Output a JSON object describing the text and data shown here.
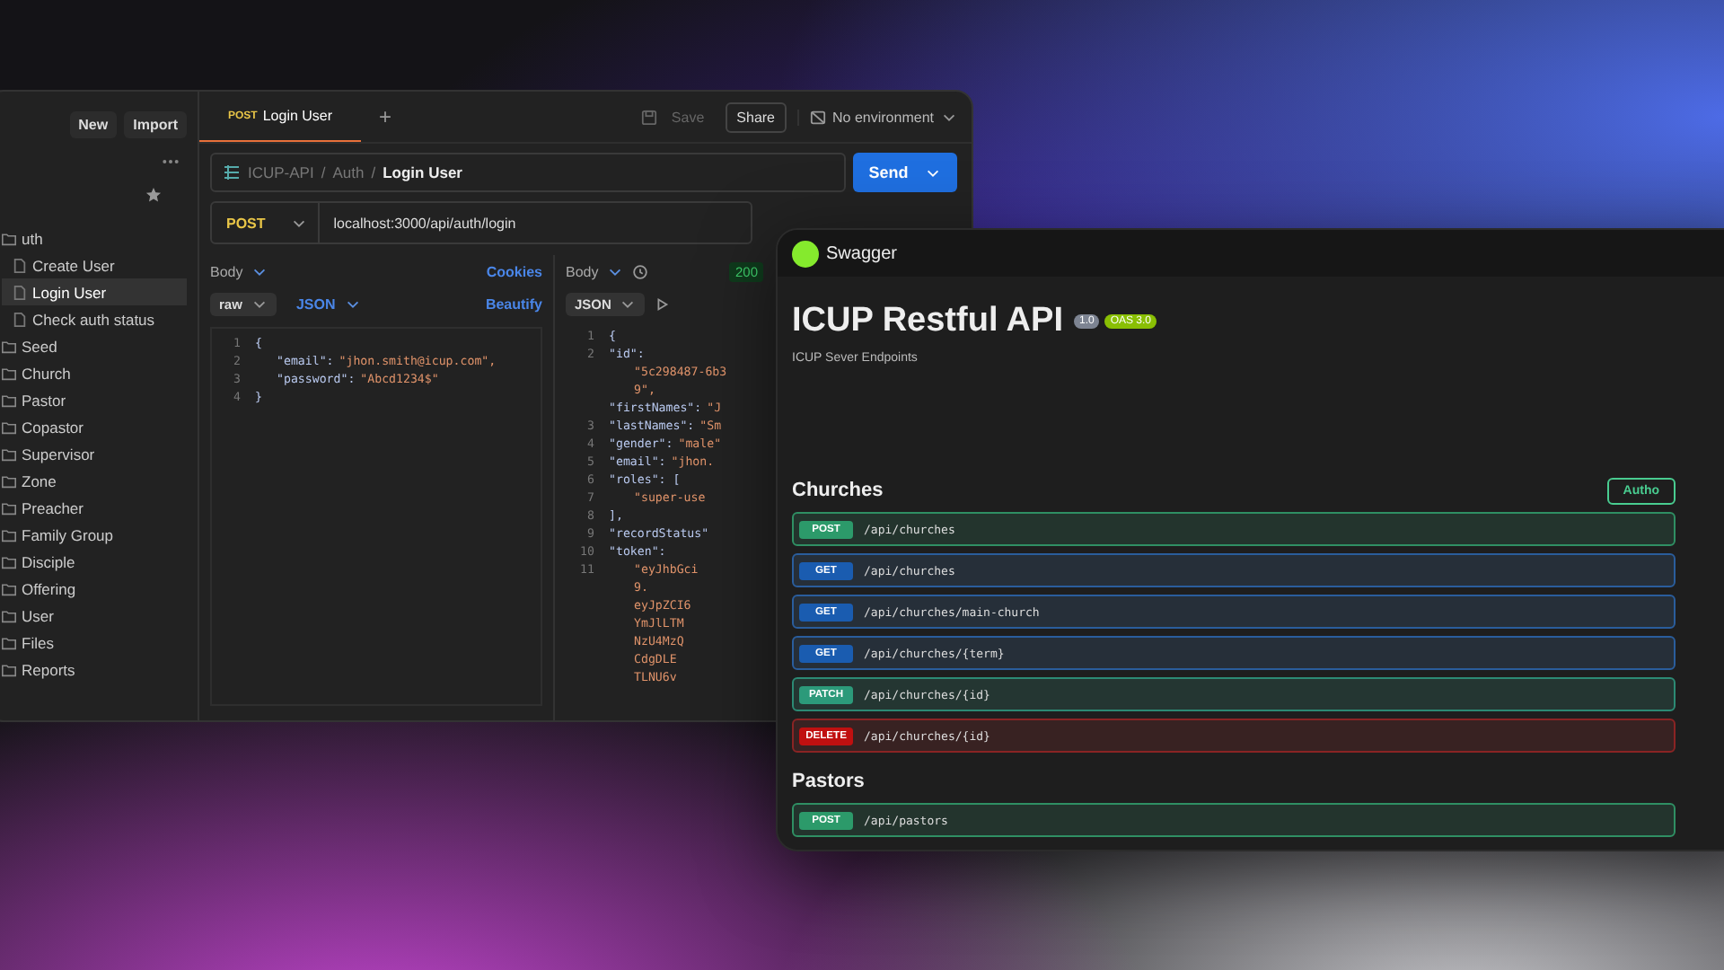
{
  "postman": {
    "sidebar": {
      "buttons": [
        "New",
        "Import"
      ],
      "items": [
        {
          "label": "uth",
          "kind": "folder",
          "selected": false,
          "children": [
            {
              "label": "Create User",
              "kind": "request",
              "selected": false
            },
            {
              "label": "Login User",
              "kind": "request",
              "selected": true
            },
            {
              "label": "Check auth status",
              "kind": "request",
              "selected": false
            }
          ]
        },
        {
          "label": "Seed",
          "kind": "folder",
          "selected": false
        },
        {
          "label": "Church",
          "kind": "folder",
          "selected": false
        },
        {
          "label": "Pastor",
          "kind": "folder",
          "selected": false
        },
        {
          "label": "Copastor",
          "kind": "folder",
          "selected": false
        },
        {
          "label": "Supervisor",
          "kind": "folder",
          "selected": false
        },
        {
          "label": "Zone",
          "kind": "folder",
          "selected": false
        },
        {
          "label": "Preacher",
          "kind": "folder",
          "selected": false
        },
        {
          "label": "Family Group",
          "kind": "folder",
          "selected": false
        },
        {
          "label": "Disciple",
          "kind": "folder",
          "selected": false
        },
        {
          "label": "Offering",
          "kind": "folder",
          "selected": false
        },
        {
          "label": "User",
          "kind": "folder",
          "selected": false
        },
        {
          "label": "Files",
          "kind": "folder",
          "selected": false
        },
        {
          "label": "Reports",
          "kind": "folder",
          "selected": false
        }
      ]
    },
    "tabs": [
      {
        "method": "POST",
        "label": "Login User",
        "selected": true
      }
    ],
    "add_tab": "+",
    "environment": "No environment",
    "save": "Save",
    "share": "Share",
    "breadcrumb": {
      "parts": [
        "ICUP-API",
        "Auth",
        "Login User"
      ],
      "separator": "/"
    },
    "send": "Send",
    "request": {
      "method": "POST",
      "url": "localhost:3000/api/auth/login",
      "body_label": "Body",
      "cookies": "Cookies",
      "beautify": "Beautify",
      "mode": "raw",
      "format": "JSON",
      "lines": [
        {
          "num": "1",
          "key": "{"
        },
        {
          "num": "2",
          "key": "\"email\":",
          "value": "\"jhon.smith@icup.com\","
        },
        {
          "num": "3",
          "key": "\"password\":",
          "value": "\"Abcd1234$\""
        },
        {
          "num": "4",
          "key": "}"
        }
      ]
    },
    "response": {
      "body_label": "Body",
      "format": "JSON",
      "status": "200",
      "lines": [
        {
          "num": "1",
          "key": "{"
        },
        {
          "num": "2",
          "key": "\"id\":"
        },
        {
          "value": "\"5c298487-6b3"
        },
        {
          "value": "9\","
        },
        {
          "key": "\"firstNames\":",
          "value": "\"J"
        },
        {
          "num": "3",
          "key": "\"lastNames\":",
          "value": "\"Sm"
        },
        {
          "num": "4",
          "key": "\"gender\":",
          "value": "\"male\""
        },
        {
          "num": "5",
          "key": "\"email\":",
          "value": "\"jhon."
        },
        {
          "num": "6",
          "key": "\"roles\": ["
        },
        {
          "num": "7",
          "value": "\"super-use"
        },
        {
          "num": "8",
          "key": "],"
        },
        {
          "num": "9",
          "key": "\"recordStatus\""
        },
        {
          "num": "10",
          "key": "\"token\":"
        },
        {
          "num": "11",
          "value": "\"eyJhbGci"
        },
        {
          "value": "9."
        },
        {
          "value": "eyJpZCI6"
        },
        {
          "value": "YmJlLTM"
        },
        {
          "value": "NzU4MzQ"
        },
        {
          "value": "CdgDLE"
        },
        {
          "value": "TLNU6v"
        }
      ]
    }
  },
  "swagger": {
    "brand": "Swagger",
    "title": "ICUP Restful API",
    "version": "1.0",
    "oas": "OAS 3.0",
    "description": "ICUP Sever Endpoints",
    "authorize": "Autho",
    "sections": [
      {
        "name": "Churches",
        "endpoints": [
          {
            "method": "POST",
            "kind": "post",
            "path": "/api/churches"
          },
          {
            "method": "GET",
            "kind": "get",
            "path": "/api/churches"
          },
          {
            "method": "GET",
            "kind": "get",
            "path": "/api/churches/main-church"
          },
          {
            "method": "GET",
            "kind": "get",
            "path": "/api/churches/{term}"
          },
          {
            "method": "PATCH",
            "kind": "patch",
            "path": "/api/churches/{id}"
          },
          {
            "method": "DELETE",
            "kind": "delete",
            "path": "/api/churches/{id}"
          }
        ]
      },
      {
        "name": "Pastors",
        "endpoints": [
          {
            "method": "POST",
            "kind": "post",
            "path": "/api/pastors"
          }
        ]
      }
    ]
  }
}
